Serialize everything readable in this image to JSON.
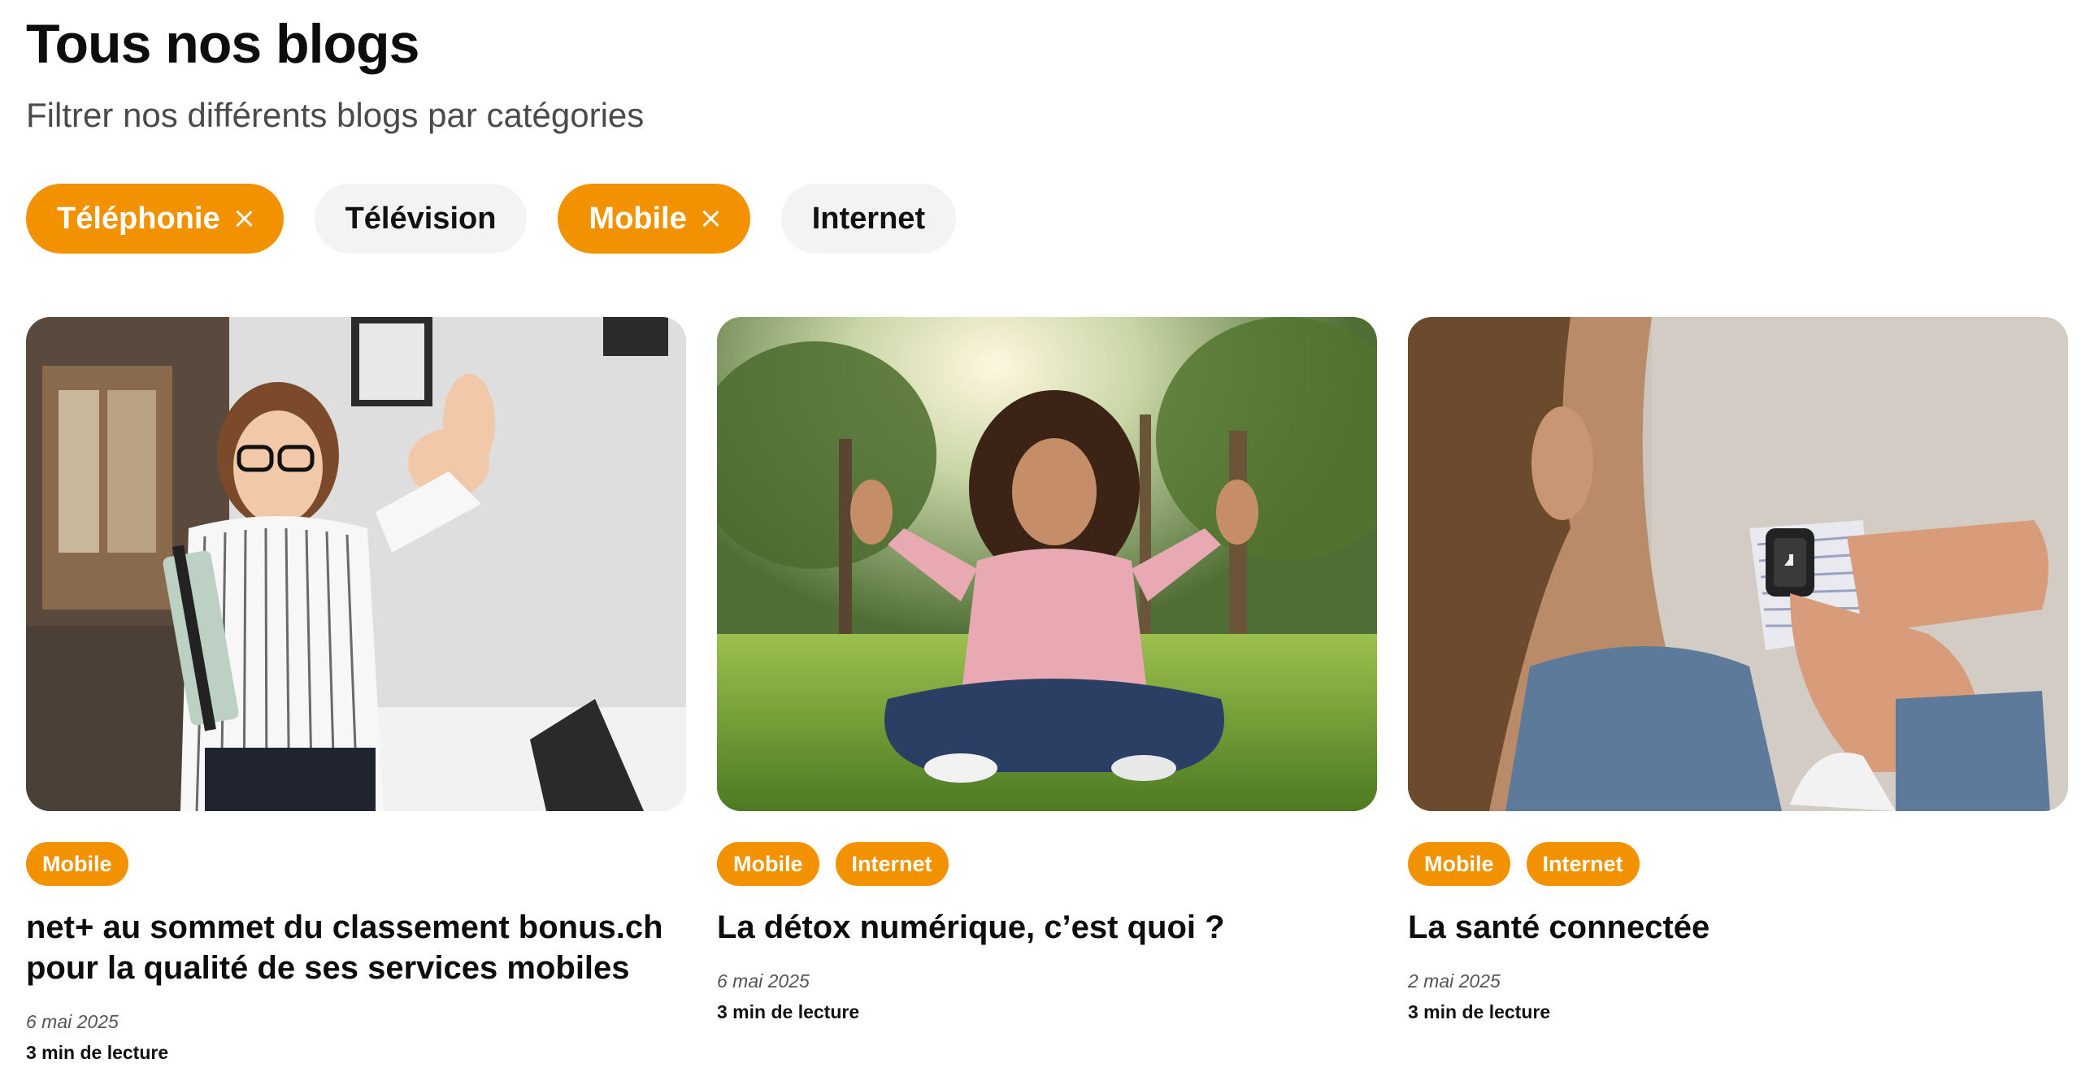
{
  "header": {
    "title": "Tous nos blogs",
    "subtitle": "Filtrer nos différents blogs par catégories"
  },
  "filters": [
    {
      "label": "Téléphonie",
      "active": true
    },
    {
      "label": "Télévision",
      "active": false
    },
    {
      "label": "Mobile",
      "active": true
    },
    {
      "label": "Internet",
      "active": false
    }
  ],
  "posts": [
    {
      "tags": [
        "Mobile"
      ],
      "title": "net+ au sommet du classement bonus.ch pour la qualité de ses services mobiles",
      "date": "6 mai 2025",
      "read_time": "3 min de lecture"
    },
    {
      "tags": [
        "Mobile",
        "Internet"
      ],
      "title": "La détox numérique, c’est quoi ?",
      "date": "6 mai 2025",
      "read_time": "3 min de lecture"
    },
    {
      "tags": [
        "Mobile",
        "Internet"
      ],
      "title": "La santé connectée",
      "date": "2 mai 2025",
      "read_time": "3 min de lecture"
    }
  ],
  "colors": {
    "accent": "#f39200",
    "chip_inactive_bg": "#f3f3f3",
    "text": "#111111"
  },
  "icons": {
    "chip_remove": "close-icon"
  }
}
